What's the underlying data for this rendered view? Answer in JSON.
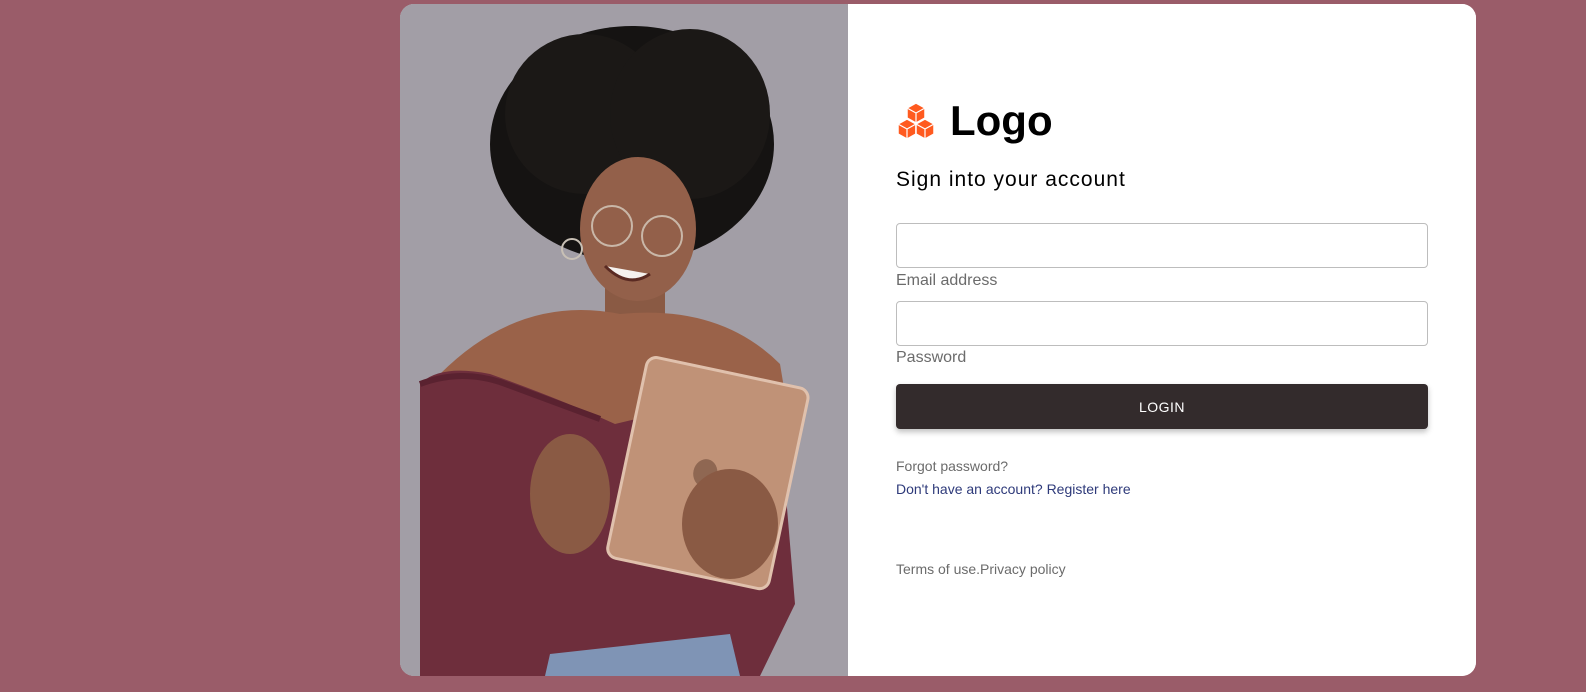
{
  "colors": {
    "page_background": "#9a5c69",
    "card_background": "#ffffff",
    "button_background": "#332b2c",
    "button_text": "#ffffff",
    "link_color": "#2e3a7a",
    "muted_text": "#6b6b6b",
    "brand_icon": "#ff5a1f"
  },
  "image": {
    "description_icon": "person-with-tablet-photo"
  },
  "brand": {
    "icon": "cubes-icon",
    "name": "Logo"
  },
  "form": {
    "heading": "Sign into your account",
    "email": {
      "label": "Email address",
      "value": ""
    },
    "password": {
      "label": "Password",
      "value": ""
    },
    "login_label": "LOGIN"
  },
  "links": {
    "forgot_password": "Forgot password?",
    "register_prompt": "Don't have an account?",
    "register_link": "Register here"
  },
  "footer": {
    "terms": "Terms of use.",
    "privacy": "Privacy policy"
  }
}
